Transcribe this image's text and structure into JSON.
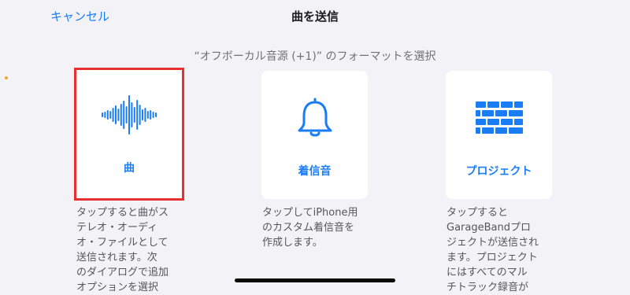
{
  "nav": {
    "cancel_label": "キャンセル",
    "title": "曲を送信"
  },
  "subtitle": "“オフボーカル音源 (+1)” のフォーマットを選択",
  "options": [
    {
      "label": "曲",
      "icon": "waveform-icon",
      "selected": true,
      "description": "タップすると曲がス\nテレオ・オーディ\nオ・ファイルとして\n送信されます。次\nのダイアログで追加\nオプションを選択"
    },
    {
      "label": "着信音",
      "icon": "bell-icon",
      "selected": false,
      "description": "タップしてiPhone用\nのカスタム着信音を\n作成します。"
    },
    {
      "label": "プロジェクト",
      "icon": "brick-wall-icon",
      "selected": false,
      "description": "タップすると\nGarageBandプロ\nジェクトが送信され\nます。プロジェクト\nにはすべてのマル\nチトラック録音が"
    }
  ],
  "colors": {
    "accent": "#1a7df5",
    "selection_border": "#e8302f",
    "background": "#f2f2f7",
    "card": "#ffffff"
  }
}
